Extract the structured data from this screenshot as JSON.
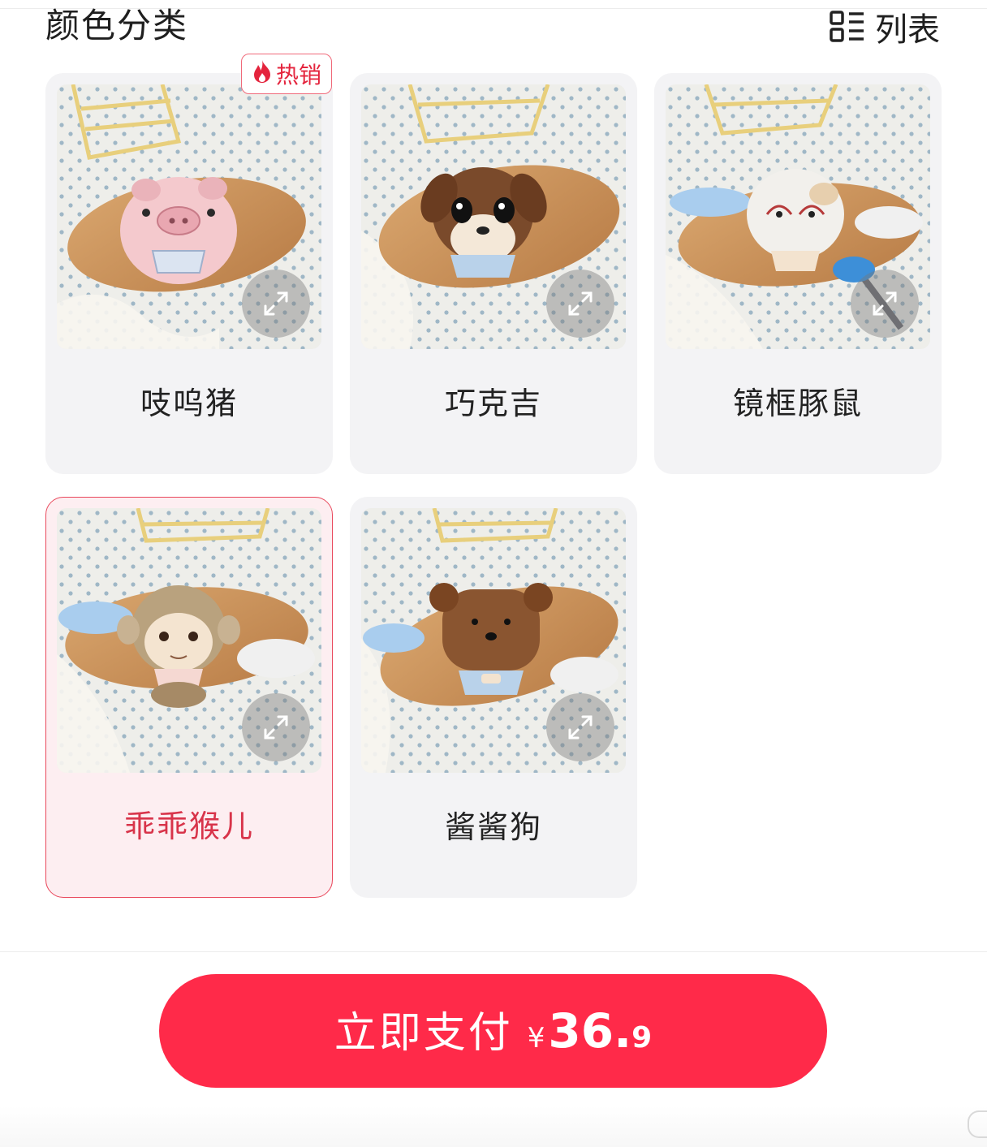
{
  "section": {
    "title": "颜色分类",
    "view_toggle_label": "列表",
    "view_toggle_icon": "list-view-icon"
  },
  "hot_badge": {
    "icon": "flame-icon",
    "label": "热销"
  },
  "items": [
    {
      "name": "吱呜猪",
      "selected": false,
      "hot": true
    },
    {
      "name": "巧克吉",
      "selected": false,
      "hot": false
    },
    {
      "name": "镜框豚鼠",
      "selected": false,
      "hot": false
    },
    {
      "name": "乖乖猴儿",
      "selected": true,
      "hot": false
    },
    {
      "name": "酱酱狗",
      "selected": false,
      "hot": false
    }
  ],
  "pay": {
    "label": "立即支付",
    "currency": "¥",
    "price_int": "36.",
    "price_dec": "9"
  },
  "colors": {
    "accent": "#ff2a49",
    "selected_text": "#d8344a",
    "card_bg": "#f3f3f5",
    "selected_bg": "#fdeef1"
  }
}
